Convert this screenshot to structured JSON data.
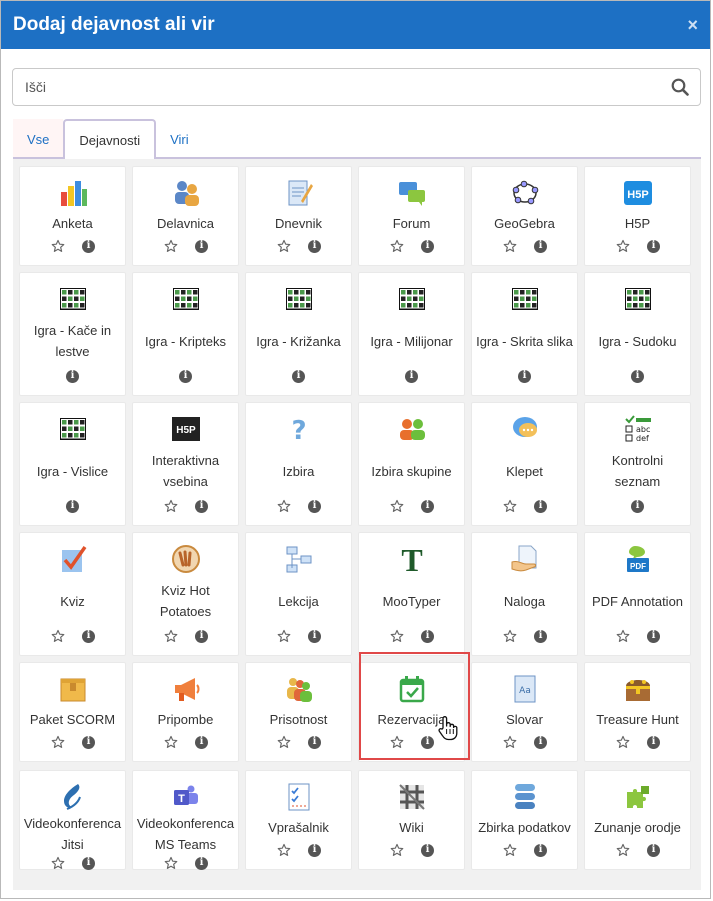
{
  "header": {
    "title": "Dodaj dejavnost ali vir",
    "close_glyph": "×"
  },
  "search": {
    "placeholder": "Išči",
    "value": ""
  },
  "tabs": [
    {
      "label": "Vse",
      "active": false
    },
    {
      "label": "Dejavnosti",
      "active": true
    },
    {
      "label": "Viri",
      "active": false
    }
  ],
  "colors": {
    "header_bg": "#1d70c4",
    "highlight": "#e04848",
    "link": "#1d70c4"
  },
  "items": [
    {
      "name": "Anketa",
      "icon": "bar-chart-icon",
      "star": true
    },
    {
      "name": "Delavnica",
      "icon": "workshop-icon",
      "star": true
    },
    {
      "name": "Dnevnik",
      "icon": "journal-icon",
      "star": true
    },
    {
      "name": "Forum",
      "icon": "forum-icon",
      "star": true
    },
    {
      "name": "GeoGebra",
      "icon": "geogebra-icon",
      "star": true
    },
    {
      "name": "H5P",
      "icon": "h5p-icon",
      "star": true
    },
    {
      "name": "Igra - Kače in lestve",
      "icon": "game-grid-icon",
      "star": false
    },
    {
      "name": "Igra - Kripteks",
      "icon": "game-grid-icon",
      "star": false
    },
    {
      "name": "Igra - Križanka",
      "icon": "game-grid-icon",
      "star": false
    },
    {
      "name": "Igra - Milijonar",
      "icon": "game-grid-icon",
      "star": false
    },
    {
      "name": "Igra - Skrita slika",
      "icon": "game-grid-icon",
      "star": false
    },
    {
      "name": "Igra - Sudoku",
      "icon": "game-grid-icon",
      "star": false
    },
    {
      "name": "Igra - Vislice",
      "icon": "game-grid-icon",
      "star": false
    },
    {
      "name": "Interaktivna vsebina",
      "icon": "h5p-dark-icon",
      "star": true
    },
    {
      "name": "Izbira",
      "icon": "question-icon",
      "star": true
    },
    {
      "name": "Izbira skupine",
      "icon": "group-choice-icon",
      "star": true
    },
    {
      "name": "Klepet",
      "icon": "chat-icon",
      "star": true
    },
    {
      "name": "Kontrolni seznam",
      "icon": "checklist-icon",
      "star": false
    },
    {
      "name": "Kviz",
      "icon": "quiz-icon",
      "star": true
    },
    {
      "name": "Kviz Hot Potatoes",
      "icon": "hotpot-icon",
      "star": true
    },
    {
      "name": "Lekcija",
      "icon": "lesson-icon",
      "star": true
    },
    {
      "name": "MooTyper",
      "icon": "mootyper-icon",
      "star": true
    },
    {
      "name": "Naloga",
      "icon": "assignment-icon",
      "star": true
    },
    {
      "name": "PDF Annotation",
      "icon": "pdf-annotation-icon",
      "star": true
    },
    {
      "name": "Paket SCORM",
      "icon": "scorm-package-icon",
      "star": true
    },
    {
      "name": "Pripombe",
      "icon": "megaphone-icon",
      "star": true
    },
    {
      "name": "Prisotnost",
      "icon": "attendance-icon",
      "star": true
    },
    {
      "name": "Rezervacija",
      "icon": "calendar-check-icon",
      "star": true
    },
    {
      "name": "Slovar",
      "icon": "glossary-icon",
      "star": true
    },
    {
      "name": "Treasure Hunt",
      "icon": "treasure-chest-icon",
      "star": true
    },
    {
      "name": "Videokonferenca Jitsi",
      "icon": "jitsi-icon",
      "star": true
    },
    {
      "name": "Videokonferenca MS Teams",
      "icon": "teams-icon",
      "star": true
    },
    {
      "name": "Vprašalnik",
      "icon": "questionnaire-icon",
      "star": true
    },
    {
      "name": "Wiki",
      "icon": "wiki-icon",
      "star": true
    },
    {
      "name": "Zbirka podatkov",
      "icon": "database-icon",
      "star": true
    },
    {
      "name": "Zunanje orodje",
      "icon": "puzzle-icon",
      "star": true
    }
  ]
}
